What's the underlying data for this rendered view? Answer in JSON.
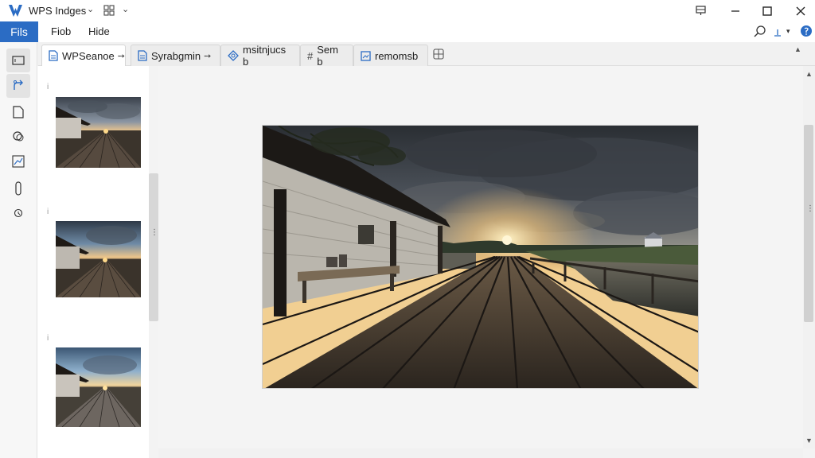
{
  "app": {
    "title": "WPS Indges",
    "brand_color": "#2b6cc4"
  },
  "menubar": {
    "file_label": "Fils",
    "items": [
      "Fiob",
      "Hide"
    ]
  },
  "tabs": [
    {
      "label": "WPSeanoe",
      "icon": "document-icon",
      "active": true
    },
    {
      "label": "Syrabgmin",
      "icon": "document-icon",
      "active": false
    },
    {
      "label": "msitnjucs b",
      "icon": "diamond-icon",
      "active": false
    },
    {
      "label": "Sem b",
      "icon": "hash-icon",
      "active": false
    },
    {
      "label": "remomsb",
      "icon": "image-file-icon",
      "active": false
    }
  ],
  "leftrail": {
    "items": [
      "slides-icon",
      "share-icon",
      "page-icon",
      "search-icon",
      "chart-icon",
      "clip-icon",
      "history-icon"
    ]
  },
  "thumbnails": {
    "marker": "i",
    "count": 3
  },
  "icons": {
    "search": "search-icon",
    "user": "user-icon",
    "help": "help-icon"
  }
}
